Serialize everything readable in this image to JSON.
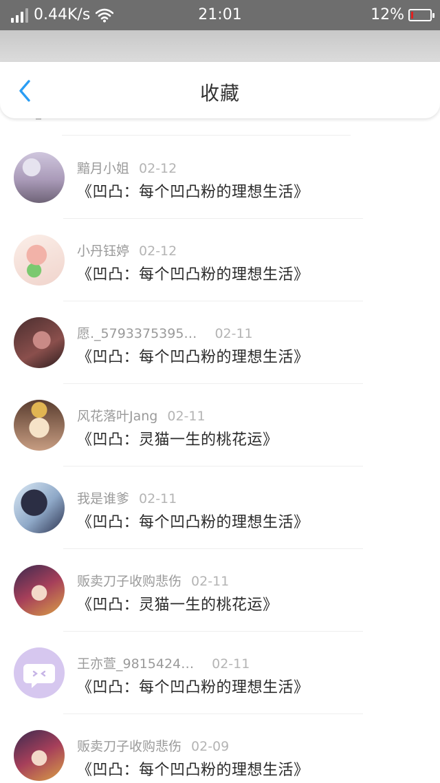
{
  "status_bar": {
    "speed": "0.44K/s",
    "time": "21:01",
    "battery": "12%",
    "battery_level": 0.12,
    "icons": [
      "signal-icon",
      "wifi-icon",
      "battery-icon"
    ]
  },
  "header": {
    "title": "收藏",
    "back_icon": "chevron-left-icon",
    "accent_color": "#2a9df4"
  },
  "items": [
    {
      "user": "黯月小姐",
      "date": "02-12",
      "title": "《凹凸：每个凹凸粉的理想生活》",
      "avatar": "avatar-image"
    },
    {
      "user": "小丹钰婷",
      "date": "02-12",
      "title": "《凹凸：每个凹凸粉的理想生活》",
      "avatar": "avatar-image"
    },
    {
      "user": "愿._5793375395…",
      "date": "02-11",
      "title": "《凹凸：每个凹凸粉的理想生活》",
      "avatar": "avatar-image"
    },
    {
      "user": "风花落叶Jang",
      "date": "02-11",
      "title": "《凹凸：灵猫一生的桃花运》",
      "avatar": "avatar-image"
    },
    {
      "user": "我是谁爹",
      "date": "02-11",
      "title": "《凹凸：每个凹凸粉的理想生活》",
      "avatar": "avatar-image"
    },
    {
      "user": "贩卖刀子收购悲伤",
      "date": "02-11",
      "title": "《凹凸：灵猫一生的桃花运》",
      "avatar": "avatar-image"
    },
    {
      "user": "王亦萱_9815424…",
      "date": "02-11",
      "title": "《凹凸：每个凹凸粉的理想生活》",
      "avatar": "default-chat-avatar-icon"
    },
    {
      "user": "贩卖刀子收购悲伤",
      "date": "02-09",
      "title": "《凹凸：每个凹凸粉的理想生活》",
      "avatar": "avatar-image"
    }
  ]
}
